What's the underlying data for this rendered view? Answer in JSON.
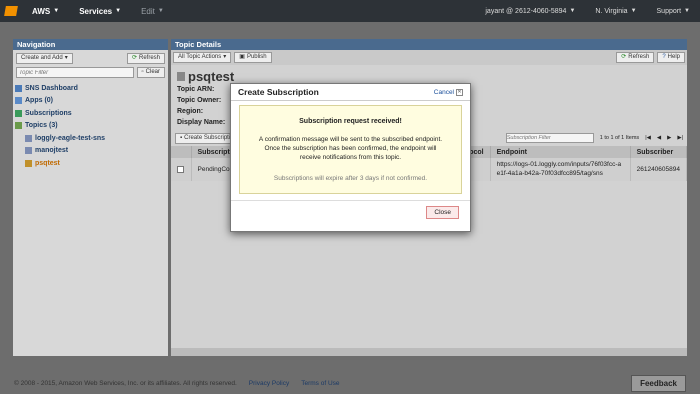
{
  "topbar": {
    "brand": "AWS",
    "services": "Services",
    "edit": "Edit",
    "account": "jayant @ 2612-4060-5894",
    "region": "N. Virginia",
    "support": "Support"
  },
  "nav": {
    "title": "Navigation",
    "create_add": "Create and Add",
    "refresh": "Refresh",
    "filter_placeholder": "Topic Filter",
    "clear": "Clear",
    "items": [
      {
        "label": "SNS Dashboard"
      },
      {
        "label": "Apps (0)"
      },
      {
        "label": "Subscriptions"
      },
      {
        "label": "Topics (3)"
      },
      {
        "label": "loggly-eagle-test-sns"
      },
      {
        "label": "manojtest"
      },
      {
        "label": "psqtest"
      }
    ]
  },
  "main": {
    "title": "Topic Details",
    "all_actions": "All Topic Actions",
    "publish": "Publish",
    "refresh": "Refresh",
    "help": "Help",
    "topic_name": "psqtest",
    "meta": [
      "Topic ARN:",
      "Topic Owner:",
      "Region:",
      "Display Name:"
    ],
    "create_sub": "Create Subscription",
    "sub_filter": "Subscription Filter",
    "pager": "1 to 1 of 1 Items",
    "columns": [
      "Subscription ID",
      "Protocol",
      "Endpoint",
      "Subscriber"
    ],
    "row": {
      "sub_id": "PendingConfirmation",
      "protocol": "",
      "endpoint": "https://logs-01.loggly.com/inputs/76f03fcc-ae1f-4a1a-b42a-70f03dfcc895/tag/sns",
      "subscriber": "261240605894"
    }
  },
  "modal": {
    "title": "Create Subscription",
    "cancel": "Cancel",
    "heading": "Subscription request received!",
    "message": "A confirmation message will be sent to the subscribed endpoint. Once the subscription has been confirmed, the endpoint will receive notifications from this topic.",
    "note": "Subscriptions will expire after 3 days if not confirmed.",
    "close": "Close"
  },
  "footer": {
    "copyright": "© 2008 - 2015, Amazon Web Services, Inc. or its affiliates. All rights reserved.",
    "privacy": "Privacy Policy",
    "terms": "Terms of Use",
    "feedback": "Feedback"
  }
}
